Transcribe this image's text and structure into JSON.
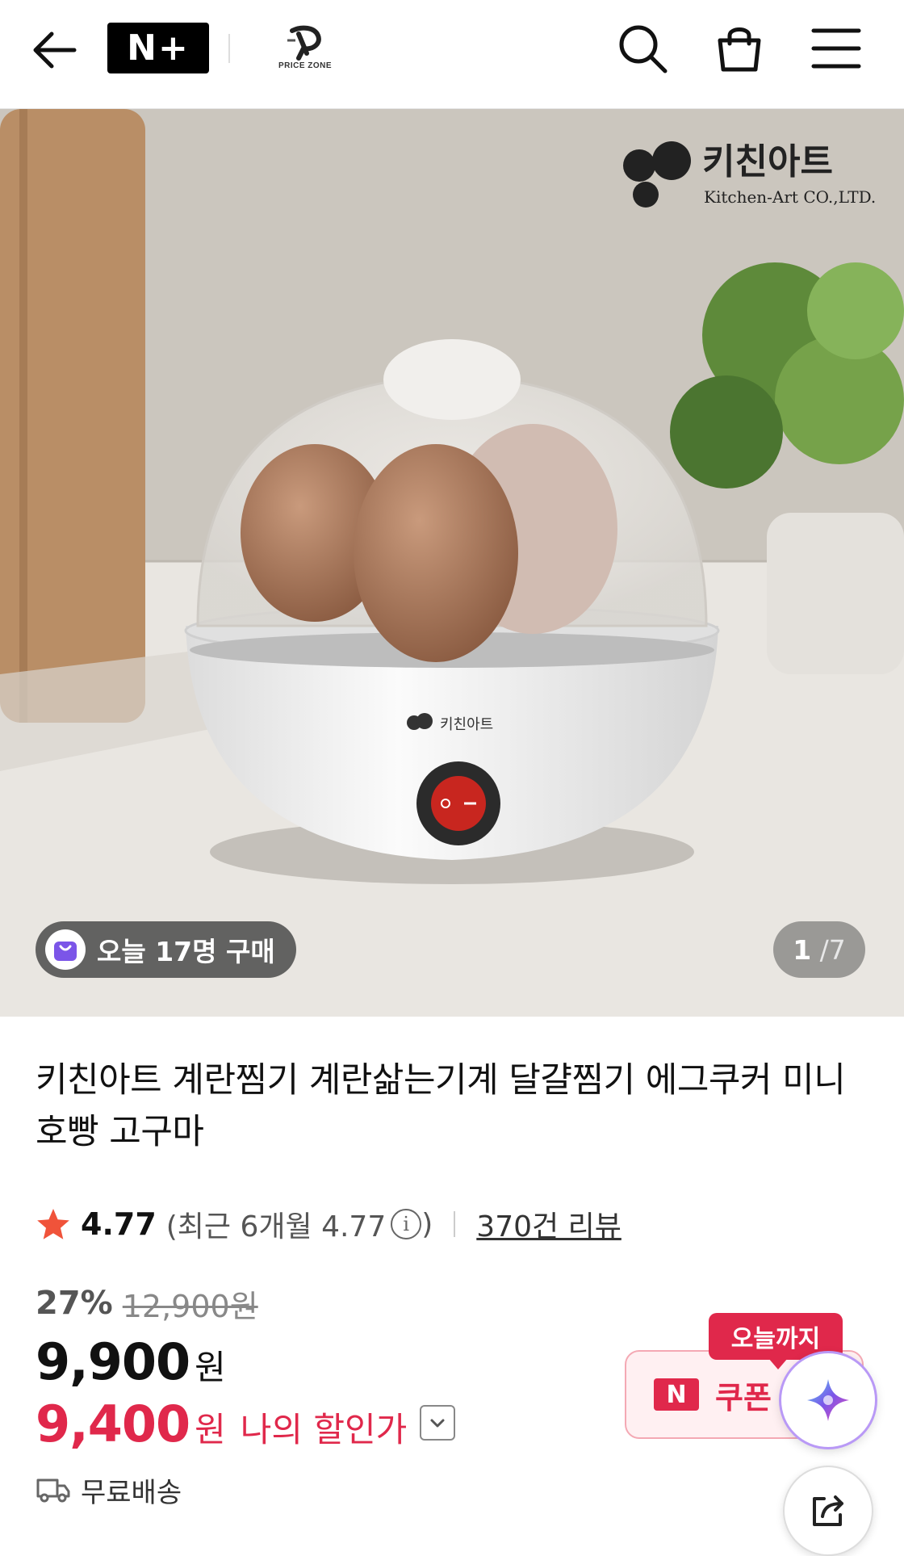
{
  "header": {
    "back_icon": "arrow-left-icon",
    "nplus_label": "N+",
    "store_logo_text": "PRICE ZONE",
    "icons": [
      "search-icon",
      "shopping-bag-icon",
      "menu-icon"
    ]
  },
  "hero": {
    "buyers_today": "오늘 17명 구매",
    "image_index": "1",
    "image_total": "7",
    "brand_logo_ko": "키친아트",
    "brand_logo_en": "Kitchen-Art CO.,LTD."
  },
  "product": {
    "title": "키친아트 계란찜기 계란삶는기계 달걀찜기 에그쿠커 미니 호빵 고구마",
    "rating": "4.77",
    "recent_rating_text": "(최근 6개월 4.77",
    "recent_rating_close": ")",
    "review_count": "370건 리뷰",
    "discount_percent": "27%",
    "original_price": "12,900원",
    "price": "9,900",
    "price_unit": "원",
    "my_price": "9,400",
    "my_price_unit": "원",
    "my_price_label": "나의 할인가",
    "shipping": "무료배송"
  },
  "coupon": {
    "tip": "오늘까지",
    "badge": "N",
    "label": "쿠폰 받"
  },
  "colors": {
    "accent": "#e0284b",
    "ai_ring": "#b999f6"
  }
}
